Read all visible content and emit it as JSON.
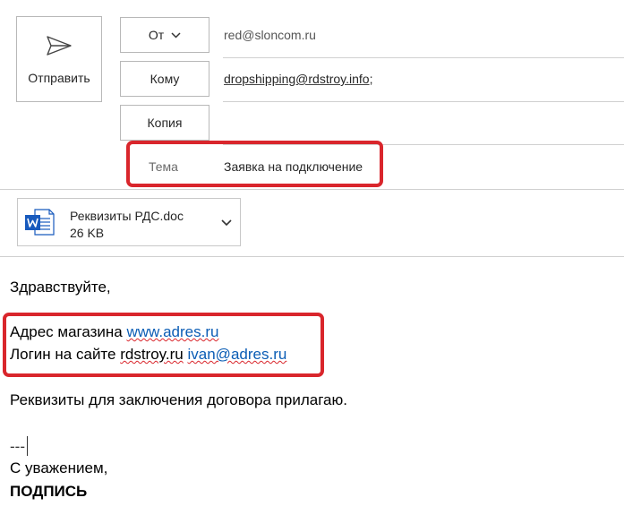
{
  "compose": {
    "send_label": "Отправить",
    "from_label": "От",
    "from_value": "red@sloncom.ru",
    "to_label": "Кому",
    "to_value": "dropshipping@rdstroy.info",
    "to_separator": ";",
    "cc_label": "Копия",
    "subject_label": "Тема",
    "subject_value": "Заявка на подключение"
  },
  "attachment": {
    "name": "Реквизиты РДС.doc",
    "size": "26 KB",
    "icon": "word-doc-icon"
  },
  "body": {
    "greeting": "Здравствуйте,",
    "shop_prefix": "Адрес магазина ",
    "shop_link": "www.adres.ru",
    "login_prefix": "Логин на сайте ",
    "login_site": "rdstroy.ru",
    "login_email": "ivan@adres.ru",
    "attach_note": "Реквизиты для заключения договора прилагаю.",
    "dashes": "---",
    "regards": "С уважением,",
    "signature": "ПОДПИСЬ"
  },
  "colors": {
    "highlight": "#d9262c",
    "link": "#0b5db5",
    "word_blue": "#185abd"
  }
}
